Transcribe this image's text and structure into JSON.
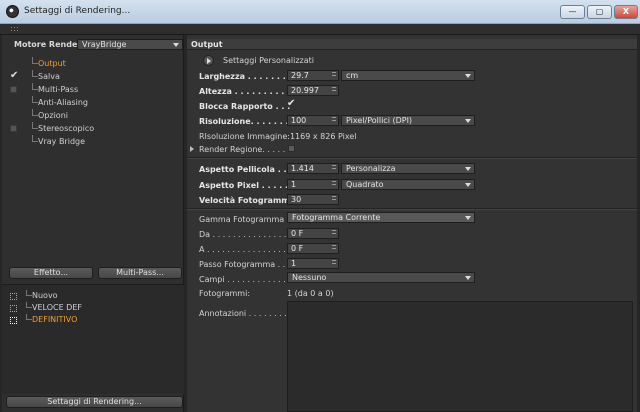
{
  "window": {
    "title": "Settaggi di Rendering...",
    "controls": [
      "—",
      "▢",
      "X"
    ]
  },
  "left": {
    "engine_label": "Motore Render",
    "engine_value": "VrayBridge",
    "tree": [
      {
        "label": "Output",
        "state": "active"
      },
      {
        "label": "Salva",
        "state": "checked"
      },
      {
        "label": "Multi-Pass",
        "state": "box"
      },
      {
        "label": "Anti-Aliasing",
        "state": "none"
      },
      {
        "label": "Opzioni",
        "state": "none"
      },
      {
        "label": "Stereoscopico",
        "state": "box"
      },
      {
        "label": "Vray Bridge",
        "state": "none"
      }
    ],
    "effect_button": "Effetto...",
    "multipass_button": "Multi-Pass...",
    "presets": [
      {
        "label": "Nuovo"
      },
      {
        "label": "VELOCE DEF"
      },
      {
        "label": "DEFINITIVO"
      }
    ],
    "settings_button": "Settaggi di Rendering..."
  },
  "right": {
    "section_title": "Output",
    "custom_label": "Settaggi  Personalizzati",
    "width_label": "Larghezza . . . . . . . . . .",
    "width_value": "29.7",
    "width_unit": "cm",
    "height_label": "Altezza . . . . . . . . . . . .",
    "height_value": "20.997",
    "lock_label": "Blocca Rapporto . . .",
    "resolution_label": "Risoluzione. . . . . . . .",
    "resolution_value": "100",
    "resolution_unit": "Pixel/Pollici (DPI)",
    "image_resolution": "RIsoluzione Immagine:1169 x 826 Pixel",
    "region_label": "Render Regione. . . . .",
    "film_aspect_label": "Aspetto Pellicola . . . .",
    "film_aspect_value": "1.414",
    "film_aspect_mode": "Personalizza",
    "pixel_aspect_label": "Aspetto Pixel . . . . . .",
    "pixel_aspect_value": "1",
    "pixel_aspect_mode": "Quadrato",
    "fps_label": "Velocità Fotogramma",
    "fps_value": "30",
    "frame_range_label": "Gamma Fotogramma",
    "frame_range_value": "Fotogramma Corrente",
    "from_label": "Da . . . . . . . . . . . . . . . .",
    "from_value": "0 F",
    "to_label": "A . . . . . . . . . . . . . . . . .",
    "to_value": "0 F",
    "step_label": "Passo Fotogramma . .",
    "step_value": "1",
    "fields_label": "Campi . . . . . . . . . . . . .",
    "fields_value": "Nessuno",
    "frames_label": "Fotogrammi:",
    "frames_value": "1 (da 0 a 0)",
    "notes_label": "Annotazioni . . . . . . . ."
  }
}
